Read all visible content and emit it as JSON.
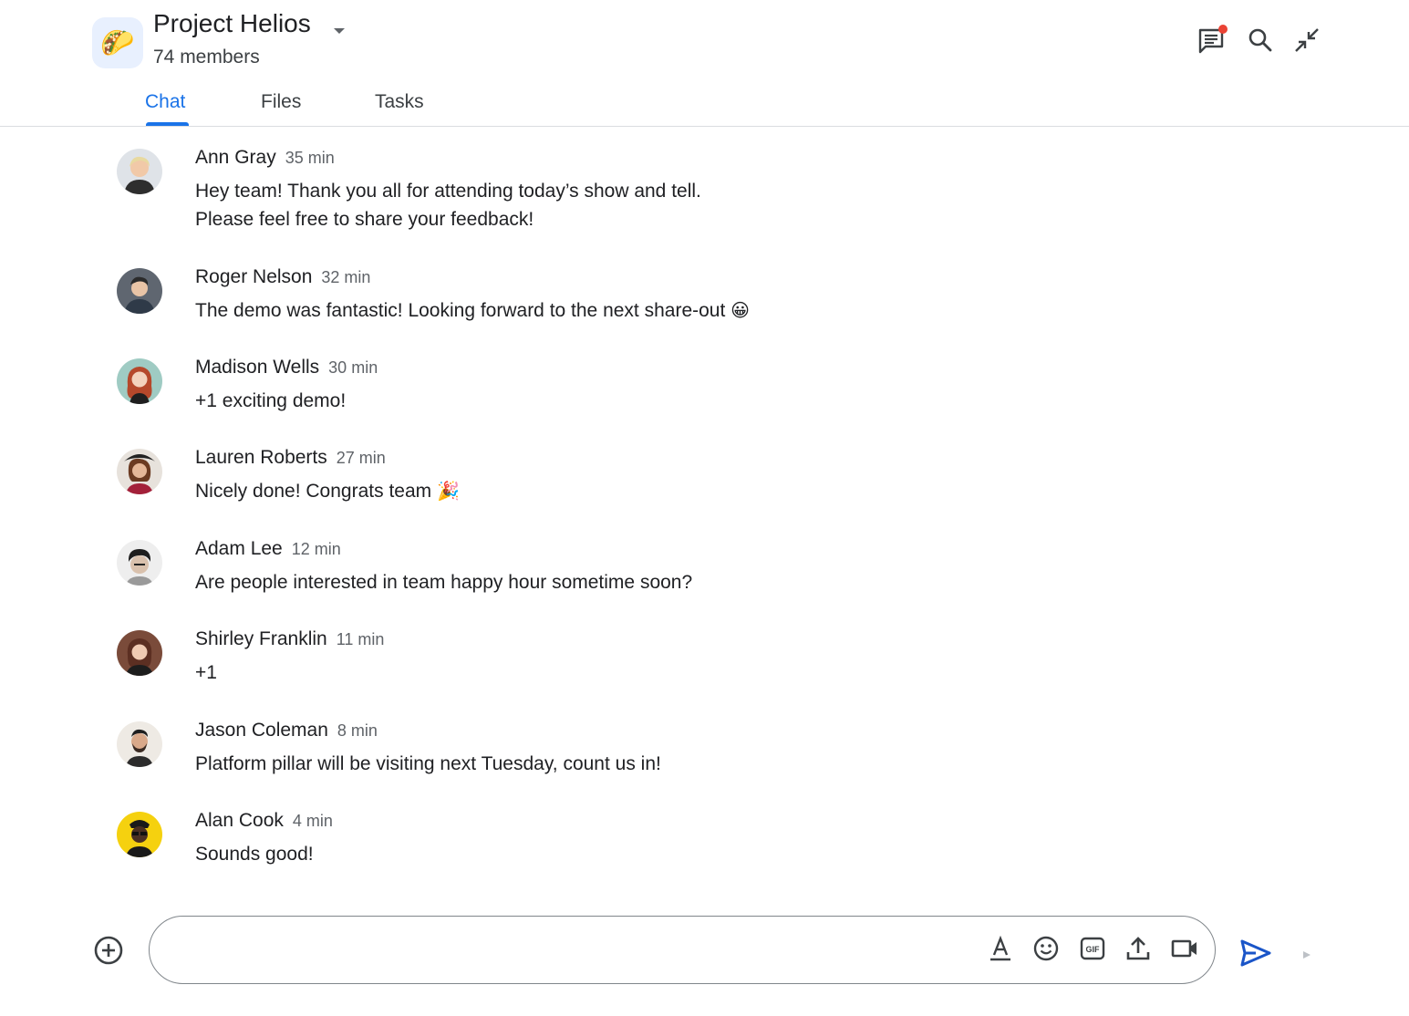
{
  "header": {
    "room_icon": "taco-emoji-icon",
    "room_emoji": "🌮",
    "title": "Project Helios",
    "subtitle": "74 members",
    "icons": {
      "threads": "threads-icon",
      "search": "search-icon",
      "minimize": "minimize-icon"
    },
    "notification_dot_color": "#ea4335"
  },
  "tabs": [
    {
      "label": "Chat",
      "active": true
    },
    {
      "label": "Files",
      "active": false
    },
    {
      "label": "Tasks",
      "active": false
    }
  ],
  "messages": [
    {
      "name": "Ann Gray",
      "time": "35 min",
      "lines": [
        "Hey team! Thank you all for attending today’s show and tell.",
        "Please feel free to share your feedback!"
      ]
    },
    {
      "name": "Roger Nelson",
      "time": "32 min",
      "lines": [
        "The demo was fantastic! Looking forward to the next share-out"
      ],
      "emoji": "😀"
    },
    {
      "name": "Madison Wells",
      "time": "30 min",
      "lines": [
        "+1 exciting demo!"
      ]
    },
    {
      "name": "Lauren Roberts",
      "time": "27 min",
      "lines": [
        "Nicely done!  Congrats team"
      ],
      "emoji": "🎉"
    },
    {
      "name": "Adam Lee",
      "time": "12 min",
      "lines": [
        "Are people interested in team happy hour sometime soon?"
      ]
    },
    {
      "name": "Shirley Franklin",
      "time": "11 min",
      "lines": [
        "+1"
      ]
    },
    {
      "name": "Jason Coleman",
      "time": "8 min",
      "lines": [
        "Platform pillar will be visiting next Tuesday, count us in!"
      ]
    },
    {
      "name": "Alan Cook",
      "time": "4 min",
      "lines": [
        "Sounds good!"
      ]
    }
  ],
  "composer": {
    "value": "",
    "placeholder": "",
    "icons": [
      "add-circle-icon",
      "text-format-icon",
      "emoji-icon",
      "gif-icon",
      "upload-icon",
      "video-call-icon",
      "send-icon"
    ]
  },
  "colors": {
    "accent": "#1a73e8",
    "send": "#1a55c8"
  }
}
